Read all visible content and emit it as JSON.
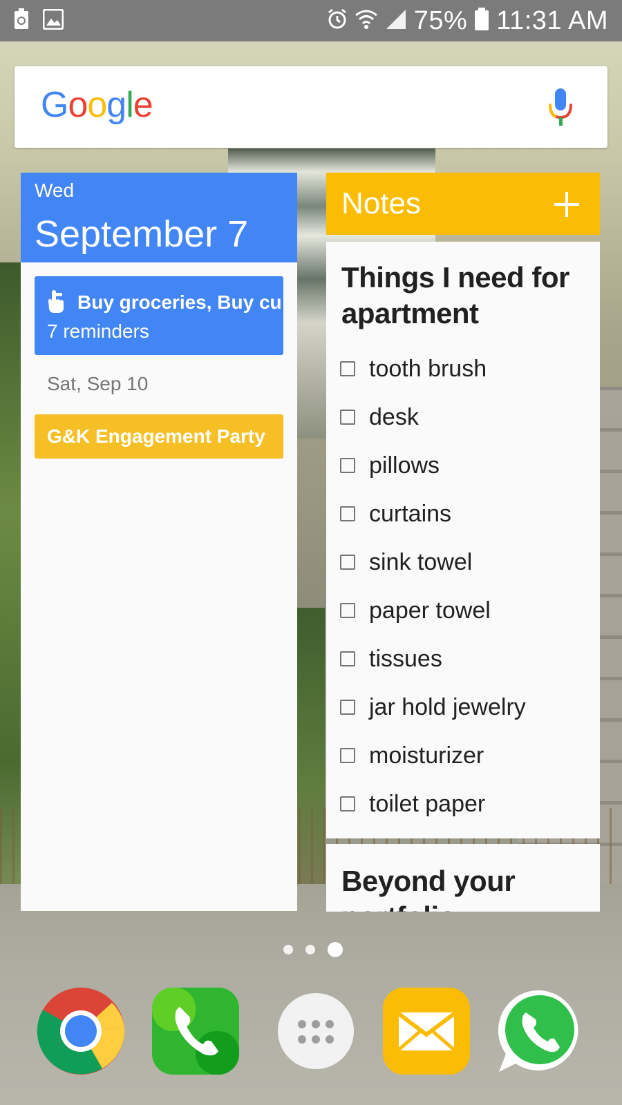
{
  "status_bar": {
    "battery_percent": "75%",
    "time": "11:31 AM",
    "left_icons": [
      "recycle-notification-icon",
      "gallery-notification-icon"
    ],
    "right_icons": [
      "alarm-icon",
      "wifi-icon",
      "signal-icon",
      "battery-icon"
    ]
  },
  "search": {
    "logo_letters": [
      "G",
      "o",
      "o",
      "g",
      "l",
      "e"
    ],
    "mic_icon": "mic-icon"
  },
  "calendar": {
    "weekday": "Wed",
    "date": "September 7",
    "reminder_title": "Buy groceries, Buy cu",
    "reminder_count": "7 reminders",
    "next_day": "Sat, Sep 10",
    "next_event": "G&K Engagement Party",
    "colors": {
      "header": "#4285f4",
      "event_yellow": "#f6bf26"
    }
  },
  "notes": {
    "header_title": "Notes",
    "add_icon": "plus-icon",
    "note_title": "Things I need for apartment",
    "items": [
      "tooth brush",
      "desk",
      "pillows",
      "curtains",
      "sink towel",
      "paper towel",
      "tissues",
      "jar hold jewelry",
      "moisturizer",
      "toilet paper"
    ],
    "next_note_title": "Beyond your portfolio",
    "colors": {
      "header": "#fbbc05"
    }
  },
  "pager": {
    "pages": 3,
    "current": 3
  },
  "dock": [
    "chrome-icon",
    "phone-icon",
    "apps-drawer-icon",
    "email-icon",
    "whatsapp-icon"
  ]
}
